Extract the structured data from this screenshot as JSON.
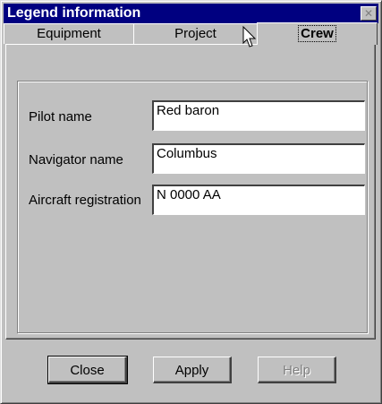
{
  "window": {
    "title": "Legend information",
    "close_icon": "close-icon"
  },
  "tabs": [
    {
      "label": "Equipment",
      "active": false
    },
    {
      "label": "Project",
      "active": false
    },
    {
      "label": "Crew",
      "active": true
    }
  ],
  "fields": [
    {
      "label": "Pilot name",
      "value": "Red baron"
    },
    {
      "label": "Navigator name",
      "value": "Columbus"
    },
    {
      "label": "Aircraft registration",
      "value": "N 0000 AA"
    }
  ],
  "buttons": {
    "close": "Close",
    "apply": "Apply",
    "help": "Help"
  }
}
